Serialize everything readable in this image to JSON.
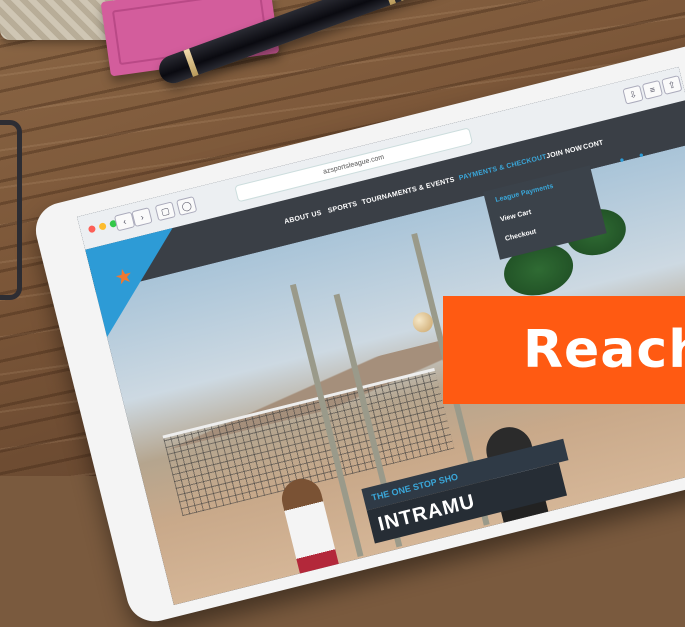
{
  "browser": {
    "url": "azsportsleague.com"
  },
  "nav": {
    "items": [
      {
        "label": "ABOUT US",
        "active": false
      },
      {
        "label": "SPORTS",
        "active": false
      },
      {
        "label": "TOURNAMENTS & EVENTS",
        "active": false
      },
      {
        "label": "PAYMENTS & CHECKOUT",
        "active": true
      },
      {
        "label": "JOIN NOW",
        "active": false
      },
      {
        "label": "CONT",
        "active": false
      }
    ],
    "dropdown": [
      {
        "label": "League Payments",
        "active": true
      },
      {
        "label": "View Cart",
        "active": false
      },
      {
        "label": "Checkout",
        "active": false
      }
    ]
  },
  "hero": {
    "tagline": "THE ONE STOP SHO",
    "headline": "INTRAMU"
  },
  "banner": {
    "text": "Reach",
    "color": "#ff5a12"
  },
  "colors": {
    "accent": "#2d9bd6",
    "nav_bg": "#3a3f46"
  }
}
